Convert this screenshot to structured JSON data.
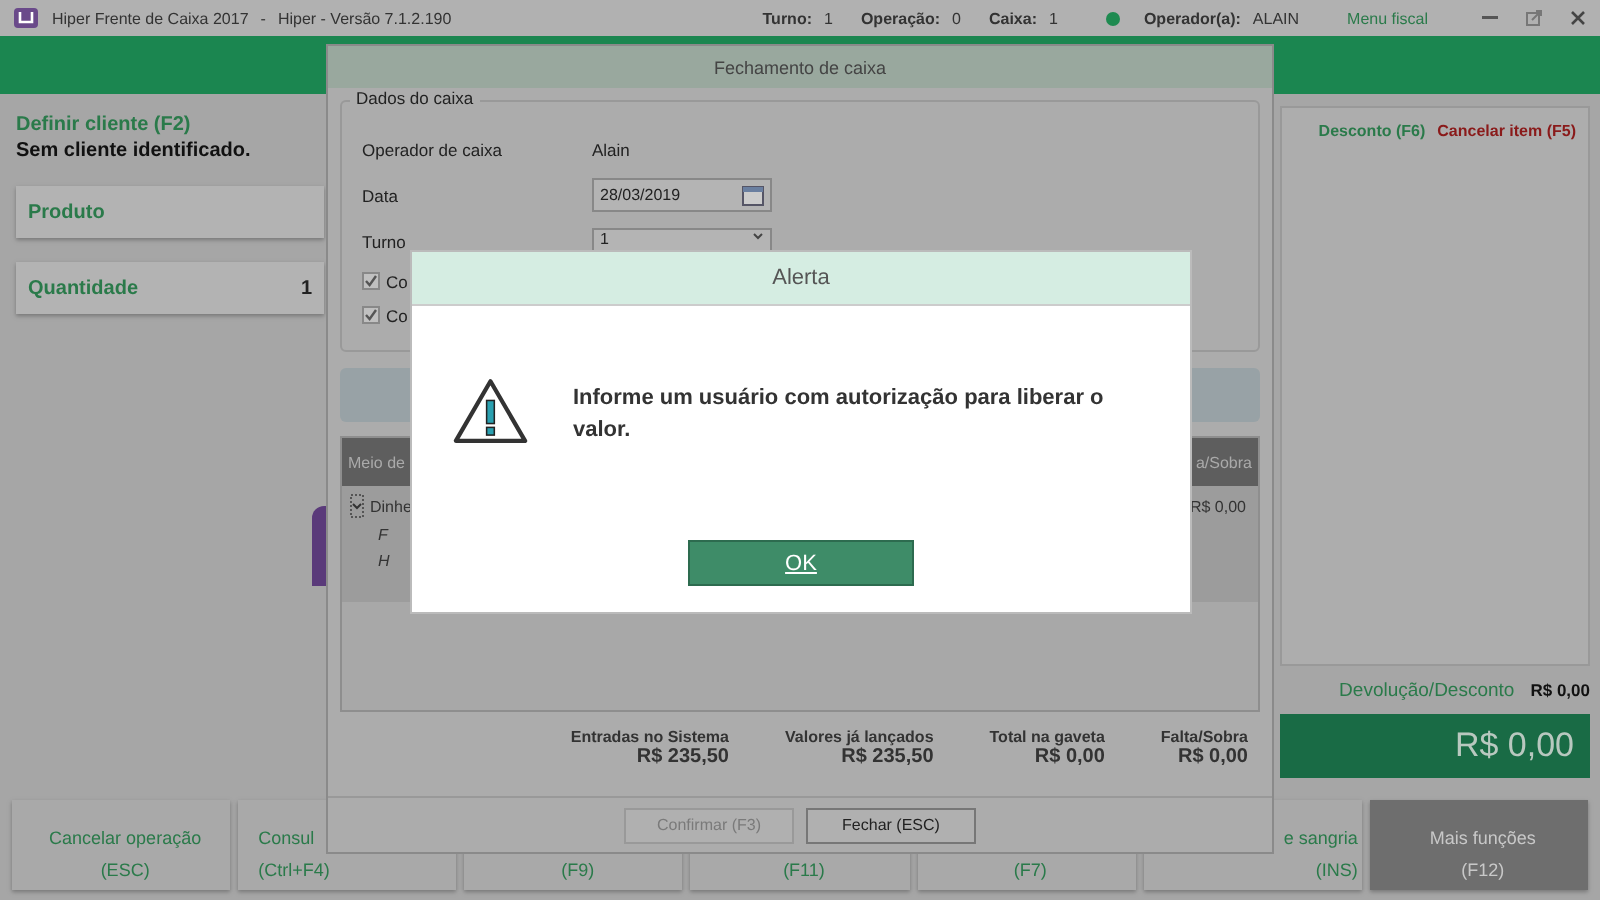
{
  "titlebar": {
    "app": "Hiper Frente de Caixa 2017",
    "separator": "-",
    "version": "Hiper - Versão 7.1.2.190",
    "stats": [
      {
        "label": "Turno:",
        "value": "1"
      },
      {
        "label": "Operação:",
        "value": "0"
      },
      {
        "label": "Caixa:",
        "value": "1"
      }
    ],
    "operator_label": "Operador(a):",
    "operator": "ALAIN",
    "menu": "Menu fiscal"
  },
  "client": {
    "link": "Definir cliente (F2)",
    "status": "Sem cliente identificado."
  },
  "fields": [
    {
      "label": "Produto"
    },
    {
      "label": "Quantidade",
      "value": "1"
    }
  ],
  "side": {
    "actions": [
      {
        "label": "Desconto (F6)",
        "color": "#2a7a4a"
      },
      {
        "label": "Cancelar item (F5)",
        "color": "#8a1a1a"
      }
    ],
    "return_label": "Devolução/Desconto",
    "return_value": "R$ 0,00",
    "total": "R$ 0,00"
  },
  "function_keys": [
    {
      "line1": "Cancelar operação",
      "line2": "(ESC)",
      "kind": "normal"
    },
    {
      "line1": "Consul",
      "line2": "(Ctrl+F4)",
      "kind": "left"
    },
    {
      "line2": "(F9)",
      "kind": "normal"
    },
    {
      "line2": "(F11)",
      "kind": "normal"
    },
    {
      "line2": "(F7)",
      "kind": "normal"
    },
    {
      "line1": "e sangria",
      "line2": "(INS)",
      "kind": "right"
    },
    {
      "line1": "Mais funções",
      "line2": "(F12)",
      "kind": "dark"
    }
  ],
  "closing_dialog": {
    "title": "Fechamento de caixa",
    "group": "Dados do caixa",
    "rows": [
      {
        "label": "Operador de caixa",
        "value": "Alain",
        "kind": "text"
      },
      {
        "label": "Data",
        "value": "28/03/2019",
        "kind": "date"
      },
      {
        "label": "Turno",
        "value": "1",
        "kind": "select"
      }
    ],
    "checks": [
      {
        "label": "Co",
        "checked": true
      },
      {
        "label": "Co",
        "checked": true
      }
    ],
    "table": {
      "columns": [
        "Meio de",
        "a/Sobra"
      ],
      "row": {
        "name": "Dinhe",
        "value": "R$ 0,00",
        "expanded": true,
        "children": [
          "F",
          "H"
        ]
      }
    },
    "totals": [
      {
        "label": "Entradas no Sistema",
        "value": "R$ 235,50"
      },
      {
        "label": "Valores já lançados",
        "value": "R$ 235,50"
      },
      {
        "label": "Total na gaveta",
        "value": "R$ 0,00"
      },
      {
        "label": "Falta/Sobra",
        "value": "R$ 0,00"
      }
    ],
    "buttons": [
      {
        "label": "Confirmar (F3)",
        "disabled": true
      },
      {
        "label": "Fechar (ESC)",
        "disabled": false
      }
    ]
  },
  "alert": {
    "title": "Alerta",
    "message": "Informe um usuário com autorização para liberar o valor.",
    "button": "OK"
  }
}
